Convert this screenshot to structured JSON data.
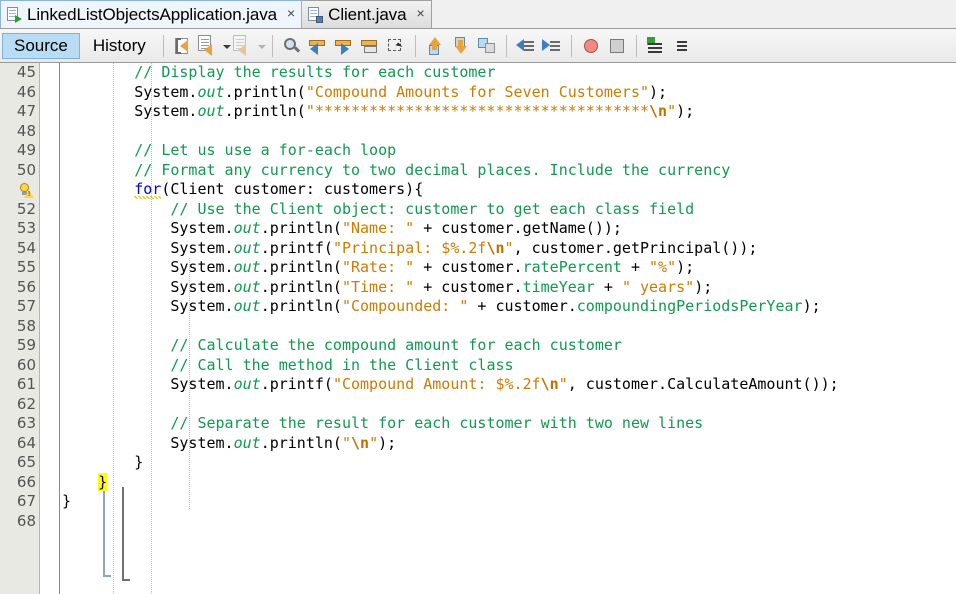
{
  "window": {
    "application": "NetBeans IDE Java Editor"
  },
  "tabs": [
    {
      "label": "LinkedListObjectsApplication.java",
      "icon": "java-main-file-icon",
      "active": true,
      "close": "×"
    },
    {
      "label": "Client.java",
      "icon": "java-class-file-icon",
      "active": false,
      "close": "×"
    }
  ],
  "view_tabs": [
    {
      "label": "Source",
      "selected": true
    },
    {
      "label": "History",
      "selected": false
    }
  ],
  "toolbar": {
    "buttons": [
      {
        "name": "last-edit-position-icon",
        "title": "Last Edit Position"
      },
      {
        "name": "toggle-rectangular-selection-icon",
        "title": "Toggle Rectangular Selection"
      },
      {
        "name": "dropdown-caret-icon",
        "title": "More"
      },
      {
        "name": "shift-line-right-icon",
        "title": "Shift Line Right"
      },
      {
        "name": "dropdown-caret-dim-icon",
        "title": "More"
      },
      {
        "name": "find-selection-icon",
        "title": "Find Selection"
      },
      {
        "name": "find-previous-icon",
        "title": "Find Previous Occurrence"
      },
      {
        "name": "find-next-icon",
        "title": "Find Next Occurrence"
      },
      {
        "name": "toggle-highlight-search-icon",
        "title": "Toggle Highlight Search"
      },
      {
        "name": "rectangular-select-icon",
        "title": "Rectangular Selection"
      },
      {
        "name": "previous-bookmark-icon",
        "title": "Previous Bookmark"
      },
      {
        "name": "next-bookmark-icon",
        "title": "Next Bookmark"
      },
      {
        "name": "toggle-bookmark-icon",
        "title": "Toggle Bookmark"
      },
      {
        "name": "shift-left-icon",
        "title": "Shift Left"
      },
      {
        "name": "shift-right-icon",
        "title": "Shift Right"
      },
      {
        "name": "toggle-breakpoint-icon",
        "title": "Toggle Breakpoint"
      },
      {
        "name": "stop-icon",
        "title": "Stop"
      },
      {
        "name": "start-macro-recording-icon",
        "title": "Start Macro Recording"
      },
      {
        "name": "stop-macro-recording-icon",
        "title": "Stop Macro Recording"
      }
    ]
  },
  "editor": {
    "first_line": 45,
    "highlighted_line": 66,
    "warning_line": 51,
    "warning_icon": "warning-bulb-icon",
    "colors": {
      "comment": "#0F9A4E",
      "string": "#CE7B00",
      "keyword": "#0000E6",
      "field": "#0F9A4E",
      "escape": "#C07000",
      "highlight": "#FFFF00",
      "gutter_bg": "#E9E9E4",
      "editor_bg": "#FFFFFF"
    },
    "lines": [
      {
        "n": "45",
        "tokens": [
          {
            "t": "        ",
            "c": ""
          },
          {
            "t": "// Display the results for each customer",
            "c": "cm"
          }
        ]
      },
      {
        "n": "46",
        "tokens": [
          {
            "t": "        System.",
            "c": ""
          },
          {
            "t": "out",
            "c": "fldi"
          },
          {
            "t": ".println(",
            "c": ""
          },
          {
            "t": "\"Compound Amounts for Seven Customers\"",
            "c": "st"
          },
          {
            "t": ");",
            "c": ""
          }
        ]
      },
      {
        "n": "47",
        "tokens": [
          {
            "t": "        System.",
            "c": ""
          },
          {
            "t": "out",
            "c": "fldi"
          },
          {
            "t": ".println(",
            "c": ""
          },
          {
            "t": "\"*************************************",
            "c": "st"
          },
          {
            "t": "\\n",
            "c": "esc"
          },
          {
            "t": "\"",
            "c": "st"
          },
          {
            "t": ");",
            "c": ""
          }
        ]
      },
      {
        "n": "48",
        "tokens": []
      },
      {
        "n": "49",
        "tokens": [
          {
            "t": "        ",
            "c": ""
          },
          {
            "t": "// Let us use a for-each loop",
            "c": "cm"
          }
        ]
      },
      {
        "n": "50",
        "tokens": [
          {
            "t": "        ",
            "c": ""
          },
          {
            "t": "// Format any currency to two decimal places. Include the currency",
            "c": "cm"
          }
        ]
      },
      {
        "n": "",
        "warn": true,
        "tokens": [
          {
            "t": "        ",
            "c": ""
          },
          {
            "t": "for",
            "c": "kw squig"
          },
          {
            "t": "(Client customer: customers){",
            "c": ""
          }
        ]
      },
      {
        "n": "52",
        "tokens": [
          {
            "t": "            ",
            "c": ""
          },
          {
            "t": "// Use the Client object: customer to get each class field",
            "c": "cm"
          }
        ]
      },
      {
        "n": "53",
        "tokens": [
          {
            "t": "            System.",
            "c": ""
          },
          {
            "t": "out",
            "c": "fldi"
          },
          {
            "t": ".println(",
            "c": ""
          },
          {
            "t": "\"Name: \"",
            "c": "st"
          },
          {
            "t": " + customer.getName());",
            "c": ""
          }
        ]
      },
      {
        "n": "54",
        "tokens": [
          {
            "t": "            System.",
            "c": ""
          },
          {
            "t": "out",
            "c": "fldi"
          },
          {
            "t": ".printf(",
            "c": ""
          },
          {
            "t": "\"Principal: $%.2f",
            "c": "st"
          },
          {
            "t": "\\n",
            "c": "esc"
          },
          {
            "t": "\"",
            "c": "st"
          },
          {
            "t": ", customer.getPrincipal());",
            "c": ""
          }
        ]
      },
      {
        "n": "55",
        "tokens": [
          {
            "t": "            System.",
            "c": ""
          },
          {
            "t": "out",
            "c": "fldi"
          },
          {
            "t": ".println(",
            "c": ""
          },
          {
            "t": "\"Rate: \"",
            "c": "st"
          },
          {
            "t": " + customer.",
            "c": ""
          },
          {
            "t": "ratePercent",
            "c": "fld"
          },
          {
            "t": " + ",
            "c": ""
          },
          {
            "t": "\"%\"",
            "c": "st"
          },
          {
            "t": ");",
            "c": ""
          }
        ]
      },
      {
        "n": "56",
        "tokens": [
          {
            "t": "            System.",
            "c": ""
          },
          {
            "t": "out",
            "c": "fldi"
          },
          {
            "t": ".println(",
            "c": ""
          },
          {
            "t": "\"Time: \"",
            "c": "st"
          },
          {
            "t": " + customer.",
            "c": ""
          },
          {
            "t": "timeYear",
            "c": "fld"
          },
          {
            "t": " + ",
            "c": ""
          },
          {
            "t": "\" years\"",
            "c": "st"
          },
          {
            "t": ");",
            "c": ""
          }
        ]
      },
      {
        "n": "57",
        "tokens": [
          {
            "t": "            System.",
            "c": ""
          },
          {
            "t": "out",
            "c": "fldi"
          },
          {
            "t": ".println(",
            "c": ""
          },
          {
            "t": "\"Compounded: \"",
            "c": "st"
          },
          {
            "t": " + customer.",
            "c": ""
          },
          {
            "t": "compoundingPeriodsPerYear",
            "c": "fld"
          },
          {
            "t": ");",
            "c": ""
          }
        ]
      },
      {
        "n": "58",
        "tokens": []
      },
      {
        "n": "59",
        "tokens": [
          {
            "t": "            ",
            "c": ""
          },
          {
            "t": "// Calculate the compound amount for each customer",
            "c": "cm"
          }
        ]
      },
      {
        "n": "60",
        "tokens": [
          {
            "t": "            ",
            "c": ""
          },
          {
            "t": "// Call the method in the Client class",
            "c": "cm"
          }
        ]
      },
      {
        "n": "61",
        "tokens": [
          {
            "t": "            System.",
            "c": ""
          },
          {
            "t": "out",
            "c": "fldi"
          },
          {
            "t": ".printf(",
            "c": ""
          },
          {
            "t": "\"Compound Amount: $%.2f",
            "c": "st"
          },
          {
            "t": "\\n",
            "c": "esc"
          },
          {
            "t": "\"",
            "c": "st"
          },
          {
            "t": ", customer.CalculateAmount());",
            "c": ""
          }
        ]
      },
      {
        "n": "62",
        "tokens": []
      },
      {
        "n": "63",
        "tokens": [
          {
            "t": "            ",
            "c": ""
          },
          {
            "t": "// Separate the result for each customer with two new lines",
            "c": "cm"
          }
        ]
      },
      {
        "n": "64",
        "tokens": [
          {
            "t": "            System.",
            "c": ""
          },
          {
            "t": "out",
            "c": "fldi"
          },
          {
            "t": ".println(",
            "c": ""
          },
          {
            "t": "\"",
            "c": "st"
          },
          {
            "t": "\\n",
            "c": "esc"
          },
          {
            "t": "\"",
            "c": "st"
          },
          {
            "t": ");",
            "c": ""
          }
        ]
      },
      {
        "n": "65",
        "tokens": [
          {
            "t": "        }",
            "c": ""
          }
        ]
      },
      {
        "n": "66",
        "tokens": [
          {
            "t": "    ",
            "c": ""
          },
          {
            "t": "}",
            "c": "hl"
          }
        ]
      },
      {
        "n": "67",
        "tokens": [
          {
            "t": "}",
            "c": ""
          }
        ]
      },
      {
        "n": "68",
        "tokens": []
      }
    ]
  }
}
